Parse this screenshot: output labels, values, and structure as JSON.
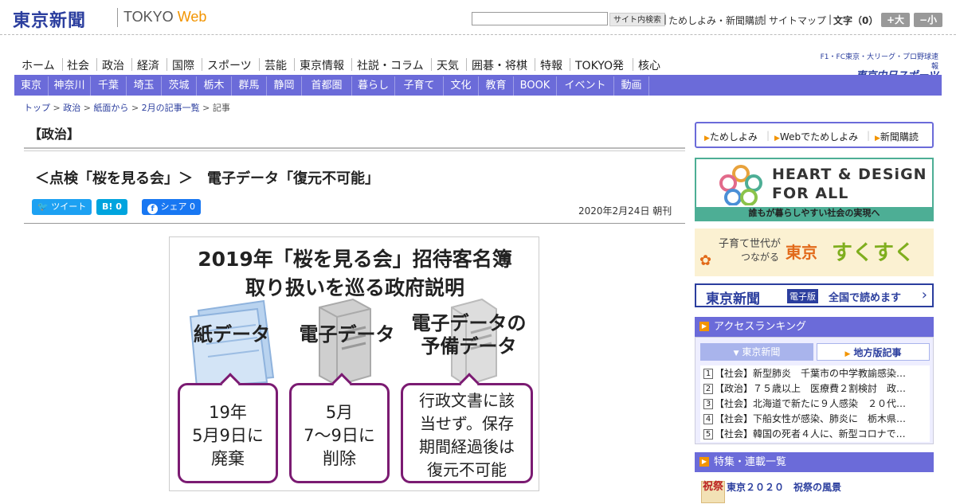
{
  "header": {
    "logo": "東京新聞",
    "logo_sub_left": "TOKYO",
    "logo_sub_right": "Web",
    "search_placeholder": "",
    "search_button": "サイト内検索",
    "link_trial": "ためしよみ・新聞購読",
    "link_sitemap": "サイトマップ",
    "fontsize_label": "文字（0）",
    "font_larger": "+大",
    "font_smaller": "−小"
  },
  "mainnav": [
    "ホーム",
    "社会",
    "政治",
    "経済",
    "国際",
    "スポーツ",
    "芸能",
    "東京情報",
    "社説・コラム",
    "天気",
    "囲碁・将棋",
    "特報",
    "TOKYO発",
    "核心"
  ],
  "chunichi": {
    "line1": "F1・FC東京・大リーグ・プロ野球速報",
    "brand": "東京中日スポーツ"
  },
  "subnav": [
    "東京",
    "神奈川",
    "千葉",
    "埼玉",
    "茨城",
    "栃木",
    "群馬",
    "静岡",
    "首都圏",
    "暮らし",
    "子育て",
    "文化",
    "教育",
    "BOOK",
    "イベント",
    "動画"
  ],
  "breadcrumb": {
    "items": [
      "トップ",
      "政治",
      "紙面から",
      "2月の記事一覧"
    ],
    "current": "記事",
    "separator": ">"
  },
  "article": {
    "category": "【政治】",
    "headline": "＜点検「桜を見る会」＞　電子データ「復元不可能」",
    "date": "2020年2月24日 朝刊",
    "share": {
      "tweet": "ツイート",
      "hatena": "B! 0",
      "facebook": "シェア 0"
    }
  },
  "figure": {
    "title_line1": "2019年「桜を見る会」招待客名簿",
    "title_line2": "取り扱いを巡る政府説明",
    "columns": [
      {
        "label_lines": [
          "紙データ"
        ],
        "bubble_lines": [
          "19年",
          "5月9日に",
          "廃棄"
        ]
      },
      {
        "label_lines": [
          "電子データ"
        ],
        "bubble_lines": [
          "5月",
          "7〜9日に",
          "削除"
        ]
      },
      {
        "label_lines": [
          "電子データの",
          "予備データ"
        ],
        "bubble_lines": [
          "行政文書に該",
          "当せず。保存",
          "期間経過後は",
          "復元不可能"
        ]
      }
    ],
    "accent_color": "#7b1b72"
  },
  "sidebar": {
    "promo_links": [
      "ためしよみ",
      "Webでためしよみ",
      "新聞購読"
    ],
    "hd_banner": {
      "line1": "HEART & DESiGN",
      "line2": "FOR ALL",
      "caption": "誰もが暮らしやすい社会の実現へ"
    },
    "sukusuku": {
      "sub1": "子育て世代が",
      "sub2": "つながる",
      "brand1": "東京",
      "brand2": "すくすく"
    },
    "edition": {
      "logo": "東京新聞",
      "tag": "電子版",
      "text": "全国で読めます"
    },
    "ranking": {
      "title": "アクセスランキング",
      "tab_active": "東京新聞",
      "tab_other": "地方版記事",
      "items": [
        "【社会】新型肺炎　千葉市の中学教諭感染…",
        "【政治】７５歳以上　医療費２割検討　政…",
        "【社会】北海道で新たに９人感染　２０代…",
        "【社会】下船女性が感染、肺炎に　栃木県…",
        "【社会】韓国の死者４人に、新型コロナで…"
      ]
    },
    "features": {
      "title": "特集・連載一覧",
      "first_item": "東京２０２０　祝祭の風景",
      "thumb_text": "祝祭"
    }
  },
  "colors": {
    "brand_blue": "#2b3e9e",
    "nav_purple": "#6b6bd9",
    "accent_orange": "#f29400"
  }
}
